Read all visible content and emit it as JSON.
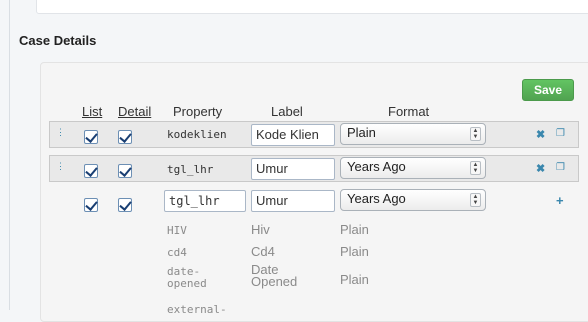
{
  "section": {
    "title": "Case Details"
  },
  "toolbar": {
    "save_label": "Save"
  },
  "headers": {
    "list": "List",
    "detail": "Detail",
    "property": "Property",
    "label": "Label",
    "format": "Format"
  },
  "rows": [
    {
      "property": "kodeklien",
      "label": "Kode Klien",
      "format": "Plain"
    },
    {
      "property": "tgl_lhr",
      "label": "Umur",
      "format": "Years Ago"
    }
  ],
  "new_row": {
    "property": "tgl_lhr",
    "label": "Umur",
    "format": "Years Ago"
  },
  "available": [
    {
      "property": "HIV",
      "label": "Hiv",
      "format": "Plain"
    },
    {
      "property": "cd4",
      "label": "Cd4",
      "format": "Plain"
    },
    {
      "property_line1": "date-",
      "property_line2": "opened",
      "label_line1": "Date",
      "label_line2": "Opened",
      "format": "Plain"
    },
    {
      "property": "external-"
    }
  ],
  "colors": {
    "accent": "#3a87ad",
    "save": "#5bb75b",
    "band": "#e9e9e9"
  },
  "icons": {
    "drag": "drag-handle-icon",
    "remove": "close-icon",
    "copy": "copy-icon",
    "add": "plus-icon",
    "select": "select-arrows-icon"
  }
}
